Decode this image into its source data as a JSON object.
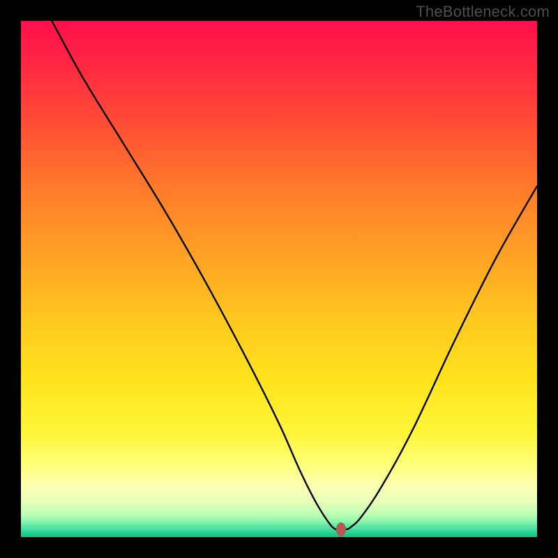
{
  "watermark": "TheBottleneck.com",
  "chart_data": {
    "type": "line",
    "title": "",
    "xlabel": "",
    "ylabel": "",
    "xlim": [
      0,
      100
    ],
    "ylim": [
      0,
      100
    ],
    "grid": false,
    "legend": false,
    "background_gradient": {
      "orientation": "vertical",
      "stops": [
        {
          "pos": 0,
          "color": "#ff0f4b"
        },
        {
          "pos": 0.22,
          "color": "#ff5433"
        },
        {
          "pos": 0.46,
          "color": "#ffa324"
        },
        {
          "pos": 0.7,
          "color": "#ffe41c"
        },
        {
          "pos": 0.86,
          "color": "#feff7a"
        },
        {
          "pos": 0.93,
          "color": "#e8ffb8"
        },
        {
          "pos": 0.97,
          "color": "#8cf6ae"
        },
        {
          "pos": 1.0,
          "color": "#10c78c"
        }
      ]
    },
    "series": [
      {
        "name": "bottleneck-curve",
        "color": "#000000",
        "x": [
          6,
          12,
          20,
          28,
          36,
          44,
          50,
          54,
          57,
          59.5,
          61,
          63,
          64,
          66,
          70,
          76,
          84,
          92,
          100
        ],
        "y": [
          100,
          89,
          76,
          63,
          49,
          34,
          22,
          13,
          7,
          3,
          1.5,
          1.5,
          2,
          4,
          10,
          21,
          38,
          54,
          68
        ]
      }
    ],
    "marker": {
      "name": "optimal-point",
      "x": 62,
      "y": 1.5,
      "color": "#b25a4b",
      "shape": "rounded-rect"
    }
  }
}
